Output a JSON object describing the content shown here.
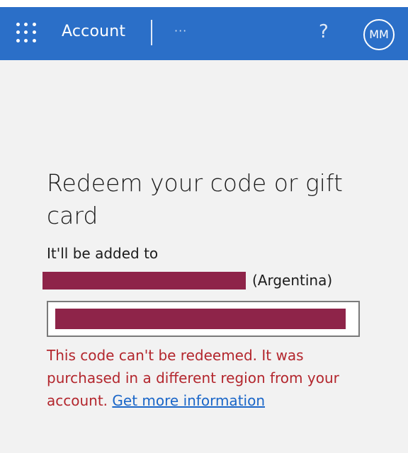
{
  "header": {
    "app_title": "Account",
    "more_label": "···",
    "help_label": "?",
    "avatar_initials": "MM"
  },
  "main": {
    "title": "Redeem your code or gift card",
    "added_to_label": "It'll be added to",
    "region": "(Argentina)",
    "error_message": "This code can't be redeemed. It was purchased in a different region from your account.",
    "error_link": "Get more information"
  },
  "colors": {
    "header_bg": "#2b6fc8",
    "error_text": "#b3262d",
    "link": "#1a66c8",
    "redaction": "#8e2449"
  }
}
